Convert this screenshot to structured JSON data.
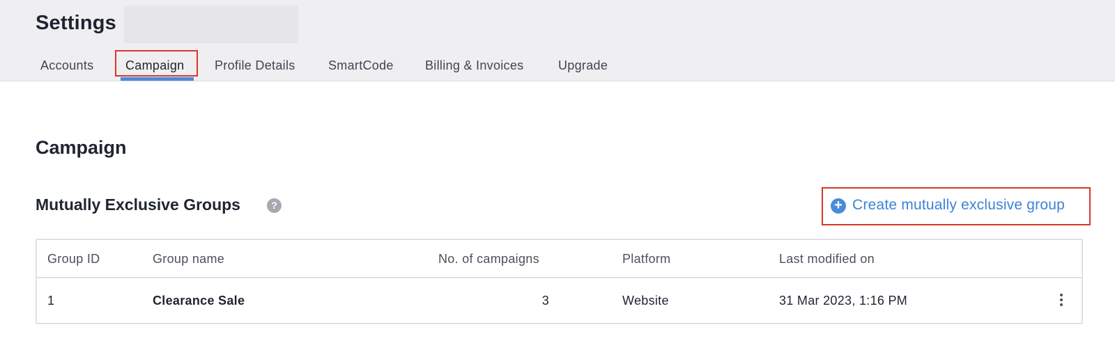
{
  "header": {
    "title": "Settings",
    "tabs": [
      {
        "label": "Accounts"
      },
      {
        "label": "Campaign"
      },
      {
        "label": "Profile Details"
      },
      {
        "label": "SmartCode"
      },
      {
        "label": "Billing & Invoices"
      },
      {
        "label": "Upgrade"
      }
    ],
    "active_tab": "Campaign"
  },
  "main": {
    "section_title": "Campaign",
    "subsection_title": "Mutually Exclusive Groups",
    "help_icon": "question-circle-icon",
    "create_button": {
      "icon": "plus-circle-icon",
      "label": "Create mutually exclusive group"
    }
  },
  "table": {
    "columns": [
      "Group ID",
      "Group name",
      "No. of campaigns",
      "Platform",
      "Last modified on"
    ],
    "rows": [
      {
        "group_id": "1",
        "group_name": "Clearance Sale",
        "campaigns": "3",
        "platform": "Website",
        "last_modified": "31 Mar 2023, 1:16 PM",
        "menu_icon": "kebab-menu-icon"
      }
    ]
  },
  "colors": {
    "accent": "#4a8bdc",
    "link": "#3c82d8",
    "highlight_border": "#d9352a",
    "header_bg": "#efeff1"
  }
}
